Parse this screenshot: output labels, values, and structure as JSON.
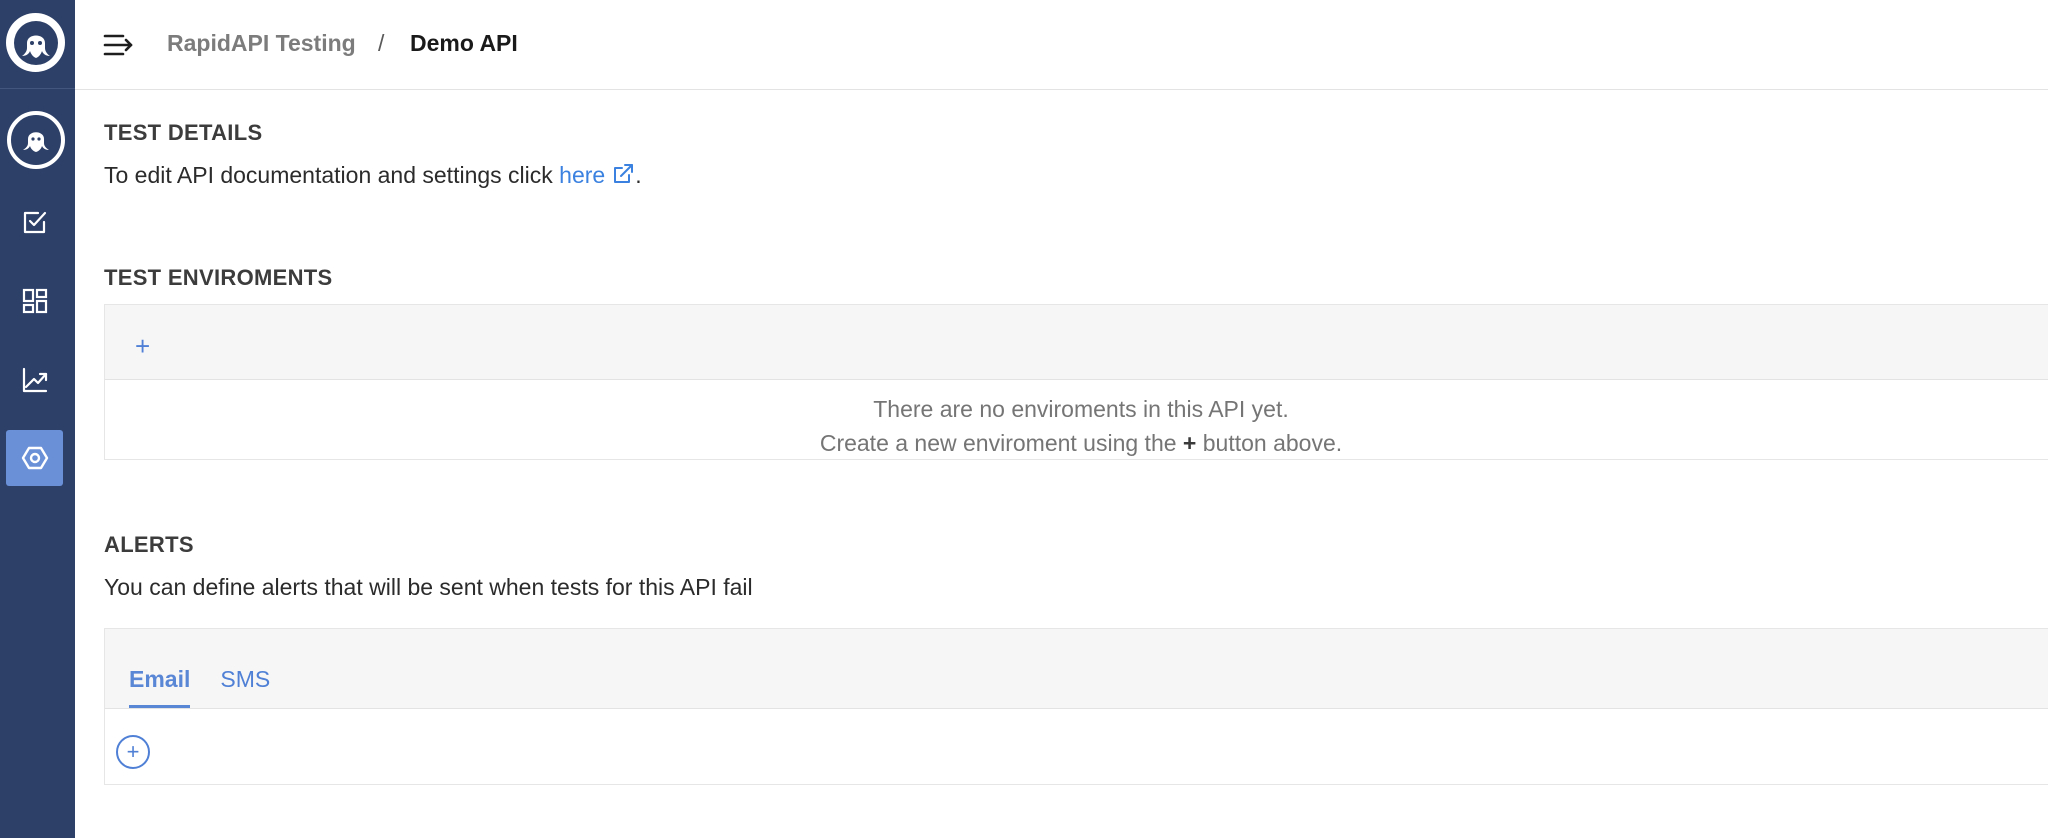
{
  "sidebar": {
    "logo_icon": "octopus-logo-icon",
    "avatar_icon": "octopus-avatar-icon",
    "items": [
      {
        "icon": "checklist-icon"
      },
      {
        "icon": "dashboard-icon"
      },
      {
        "icon": "analytics-icon"
      },
      {
        "icon": "settings-hexagon-icon",
        "active": true
      }
    ],
    "active_color": "#6a90d8",
    "background_color": "#2d4068"
  },
  "header": {
    "breadcrumb_parent": "RapidAPI Testing",
    "breadcrumb_separator": "/",
    "breadcrumb_current": "Demo API"
  },
  "test_details": {
    "title": "TEST DETAILS",
    "text": "To edit API documentation and settings click ",
    "link_label": "here",
    "text_end": "."
  },
  "environments": {
    "title": "TEST ENVIROMENTS",
    "add_label": "+",
    "empty_line1": "There are no enviroments in this API yet.",
    "empty_line2_before": "Create a new enviroment using the ",
    "empty_line2_plus": "+",
    "empty_line2_after": " button above."
  },
  "alerts": {
    "title": "ALERTS",
    "description": "You can define alerts that will be sent when tests for this API fail",
    "tabs": [
      {
        "label": "Email",
        "active": true
      },
      {
        "label": "SMS",
        "active": false
      }
    ],
    "add_label": "+"
  },
  "accent_color": "#4f80d6"
}
